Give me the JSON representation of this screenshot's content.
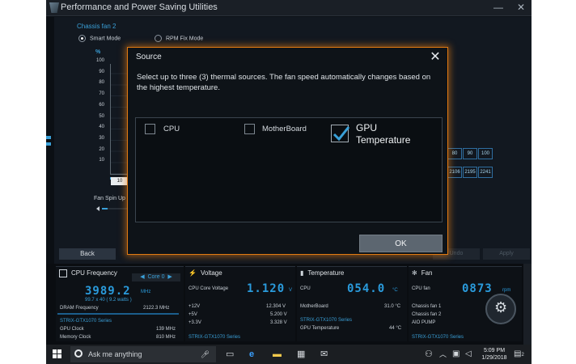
{
  "window": {
    "title": "Performance and Power Saving Utilities",
    "minimize": "—",
    "close": "✕"
  },
  "fan_tuning": {
    "section_title": "Chassis fan 2",
    "modes": [
      {
        "label": "Smart Mode",
        "selected": true
      },
      {
        "label": "RPM Fix Mode",
        "selected": false
      }
    ],
    "y_unit": "%",
    "y_ticks": [
      "100",
      "90",
      "80",
      "70",
      "60",
      "50",
      "40",
      "30",
      "20",
      "10"
    ],
    "x_label_first": "10",
    "spin_up_label": "Fan Spin Up",
    "side_values_top": [
      "80",
      "90",
      "100"
    ],
    "side_values_bottom": [
      "2106",
      "2195",
      "2241"
    ],
    "back_label": "Back",
    "undo_label": "Undo",
    "apply_label": "Apply"
  },
  "modal": {
    "title": "Source",
    "message": "Select up to three (3) thermal sources. The fan speed automatically changes based on the highest temperature.",
    "options": [
      {
        "label": "CPU",
        "checked": false
      },
      {
        "label": "MotherBoard",
        "checked": false
      },
      {
        "label": "GPU Temperature",
        "checked": true
      }
    ],
    "ok_label": "OK",
    "close_glyph": "✕"
  },
  "dashboard": {
    "cpu": {
      "title": "CPU Frequency",
      "core_select": "Core 0",
      "value": "3989.2",
      "unit": "MHz",
      "sub": "99.7  x  40   ( 9.2  watts )",
      "dram_label": "DRAM Frequency",
      "dram_value": "2122.3  MHz",
      "gpu_series": "STRIX-GTX1070 Series",
      "gpu_clock_label": "GPU Clock",
      "gpu_clock_value": "139 MHz",
      "mem_clock_label": "Memory Clock",
      "mem_clock_value": "810 MHz"
    },
    "voltage": {
      "title": "Voltage",
      "label": "CPU Core Voltage",
      "value": "1.120",
      "unit": "V",
      "rows": [
        {
          "name": "+12V",
          "value": "12.304  V"
        },
        {
          "name": "+5V",
          "value": "5.200  V"
        },
        {
          "name": "+3.3V",
          "value": "3.328  V"
        }
      ],
      "gpu_series": "STRIX-GTX1070 Series"
    },
    "temperature": {
      "title": "Temperature",
      "label": "CPU",
      "value": "054.0",
      "unit": "°C",
      "mb_label": "MotherBoard",
      "mb_value": "31.0 °C",
      "gpu_series": "STRIX-GTX1070 Series",
      "gpu_temp_label": "GPU Temperature",
      "gpu_temp_value": "44 °C"
    },
    "fan": {
      "title": "Fan",
      "label": "CPU fan",
      "value": "0873",
      "unit": "rpm",
      "rows": [
        "Chassis fan 1",
        "Chassis fan 2",
        "AIO PUMP"
      ],
      "gpu_series": "STRIX-GTX1070 Series"
    }
  },
  "taskbar": {
    "search_placeholder": "Ask me anything",
    "time": "5:09 PM",
    "date": "1/29/2018",
    "notification_count": "2"
  }
}
